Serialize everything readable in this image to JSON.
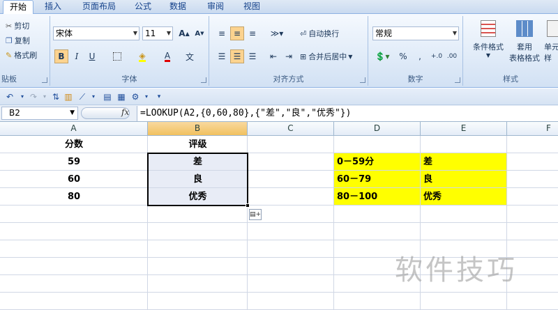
{
  "tabs": [
    {
      "label": "开始",
      "active": true
    },
    {
      "label": "插入"
    },
    {
      "label": "页面布局"
    },
    {
      "label": "公式"
    },
    {
      "label": "数据"
    },
    {
      "label": "审阅"
    },
    {
      "label": "视图"
    }
  ],
  "clipboard": {
    "cut": "剪切",
    "copy": "复制",
    "format_painter": "格式刷",
    "label": "贴板"
  },
  "font": {
    "name": "宋体",
    "size": "11",
    "grow": "A",
    "shrink": "A",
    "bold": "B",
    "italic": "I",
    "underline": "U",
    "font_color": "A",
    "phonetic": "文",
    "label": "字体"
  },
  "alignment": {
    "wrap_text": "自动换行",
    "merge_center": "合并后居中",
    "label": "对齐方式"
  },
  "number": {
    "format": "常规",
    "percent": "%",
    "comma": ",",
    "inc_decimal": "+.0",
    "dec_decimal": ".00",
    "label": "数字"
  },
  "styles": {
    "conditional": "条件格式",
    "table_format_1": "套用",
    "table_format_2": "表格格式",
    "cell_styles_1": "单元",
    "cell_styles_2": "样",
    "label": "样式"
  },
  "formula_bar": {
    "name_box": "B2",
    "fx": "fx",
    "formula": "=LOOKUP(A2,{0,60,80},{\"差\",\"良\",\"优秀\"})"
  },
  "columns": [
    "A",
    "B",
    "C",
    "D",
    "E",
    "F"
  ],
  "cells": {
    "A1": "分数",
    "B1": "评级",
    "A2": "59",
    "B2": "差",
    "A3": "60",
    "B3": "良",
    "A4": "80",
    "B4": "优秀",
    "D2": "0－59分",
    "E2": "差",
    "D3": "60－79",
    "E3": "良",
    "D4": "80－100",
    "E4": "优秀"
  },
  "colors": {
    "highlight": "#ffff00",
    "selected_header": "#f1c15f",
    "accent": "#15428b"
  },
  "watermark": "软件技巧"
}
